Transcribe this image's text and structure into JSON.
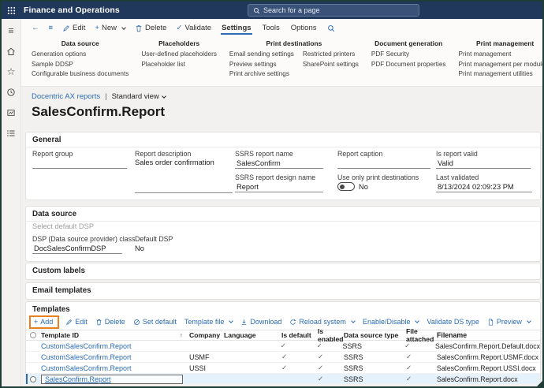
{
  "colors": {
    "accent": "#2b6cb3",
    "topbar": "#20385c",
    "selection": "#e5f1fb",
    "annotation_orange": "#e8821e"
  },
  "icons": {
    "back": "←",
    "panel_menu": "≡",
    "hamburger": "≡",
    "star": "☆",
    "plus": "+",
    "check": "✓",
    "sort_asc": "↑",
    "pipe": "|"
  },
  "topbar": {
    "app_title": "Finance and Operations",
    "search_placeholder": "Search for a page"
  },
  "action_pane": {
    "buttons": {
      "edit": "Edit",
      "new": "New",
      "delete": "Delete",
      "validate": "Validate"
    },
    "tabs": [
      {
        "label": "Settings"
      },
      {
        "label": "Tools"
      },
      {
        "label": "Options"
      }
    ],
    "groups": [
      {
        "title": "Data source",
        "links": [
          "Generation options",
          "Sample DDSP",
          "Configurable business documents"
        ]
      },
      {
        "title": "Placeholders",
        "links": [
          "User-defined placeholders",
          "Placeholder list"
        ]
      },
      {
        "title": "Print destinations",
        "links_col1": [
          "Email sending settings",
          "Preview settings",
          "Print archive settings"
        ],
        "links_col2": [
          "Restricted printers",
          "SharePoint settings"
        ]
      },
      {
        "title": "Document generation",
        "links": [
          "PDF Security",
          "PDF Document properties"
        ]
      },
      {
        "title": "Print management",
        "links": [
          "Print management",
          "Print management per module",
          "Print management utilities"
        ]
      }
    ]
  },
  "breadcrumb": {
    "link": "Docentric AX reports",
    "separator": "|",
    "view": "Standard view"
  },
  "page_title": "SalesConfirm.Report",
  "general": {
    "title": "General",
    "report_group_label": "Report group",
    "report_description_label": "Report description",
    "report_description_value": "Sales order confirmation",
    "ssrs_report_name_label": "SSRS report name",
    "ssrs_report_name_value": "SalesConfirm",
    "ssrs_design_label": "SSRS report design name",
    "ssrs_design_value": "Report",
    "report_caption_label": "Report caption",
    "use_only_label": "Use only print destinations",
    "use_only_value": "No",
    "is_valid_label": "Is report valid",
    "is_valid_value": "Valid",
    "last_validated_label": "Last validated",
    "last_validated_value": "8/13/2024 02:09:23 PM"
  },
  "data_source": {
    "title": "Data source",
    "select_default_dsp": "Select default DSP",
    "dsp_class_label": "DSP (Data source provider) class",
    "dsp_class_value": "DocSalesConfirmDSP",
    "default_dsp_label": "Default DSP",
    "default_dsp_value": "No"
  },
  "custom_labels": {
    "title": "Custom labels"
  },
  "email_templates": {
    "title": "Email templates"
  },
  "templates": {
    "title": "Templates",
    "toolbar": {
      "add": "Add",
      "edit": "Edit",
      "delete": "Delete",
      "set_default": "Set default",
      "template_file": "Template file",
      "download": "Download",
      "reload_system": "Reload system",
      "enable_disable": "Enable/Disable",
      "validate_ds": "Validate DS type",
      "preview": "Preview"
    },
    "columns": [
      "Template ID",
      "Company",
      "Language",
      "Is default",
      "Is enabled",
      "Data source type",
      "File attached",
      "Filename"
    ],
    "rows": [
      {
        "template_id": "CustomSalesConfirm.Report",
        "company": "",
        "language": "",
        "is_default": "✓",
        "is_enabled": "✓",
        "ds_type": "SSRS",
        "file_attached": "✓",
        "filename": "SalesConfirm.Report.Default.docx"
      },
      {
        "template_id": "CustomSalesConfirm.Report",
        "company": "USMF",
        "language": "",
        "is_default": "✓",
        "is_enabled": "✓",
        "ds_type": "SSRS",
        "file_attached": "✓",
        "filename": "SalesConfirm.Report.USMF.docx"
      },
      {
        "template_id": "CustomSalesConfirm.Report",
        "company": "USSI",
        "language": "",
        "is_default": "✓",
        "is_enabled": "✓",
        "ds_type": "SSRS",
        "file_attached": "✓",
        "filename": "SalesConfirm.Report.USSI.docx"
      },
      {
        "template_id": "SalesConfirm.Report",
        "company": "",
        "language": "",
        "is_default": "",
        "is_enabled": "✓",
        "ds_type": "SSRS",
        "file_attached": "✓",
        "filename": "SalesConfirm.Report.docx"
      }
    ]
  }
}
